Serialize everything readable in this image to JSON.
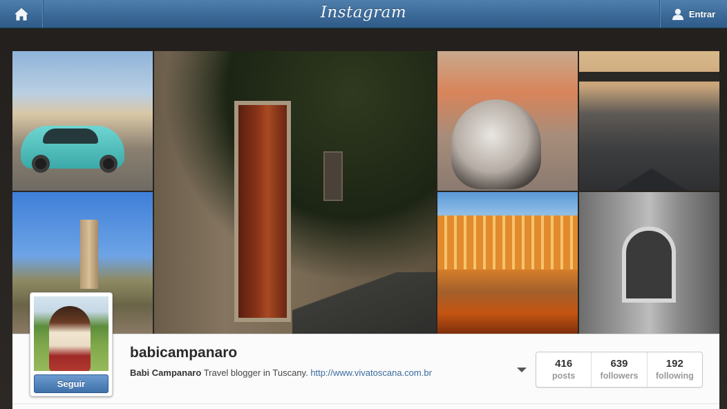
{
  "topbar": {
    "logo": "Instagram",
    "login_label": "Entrar"
  },
  "icons": {
    "home": "home-icon",
    "login": "user-icon",
    "caret": "chevron-down-icon"
  },
  "profile": {
    "username": "babicampanaro",
    "bio_name": "Babi Campanaro",
    "bio_text": " Travel blogger in Tuscany. ",
    "bio_link": "http://www.vivatoscana.com.br",
    "follow_label": "Seguir",
    "stats": [
      {
        "value": "416",
        "label": "posts"
      },
      {
        "value": "639",
        "label": "followers"
      },
      {
        "value": "192",
        "label": "following"
      }
    ]
  },
  "colors": {
    "topbar": "#3a6896",
    "follow_button": "#4f80b9",
    "link": "#3a6a9c"
  }
}
